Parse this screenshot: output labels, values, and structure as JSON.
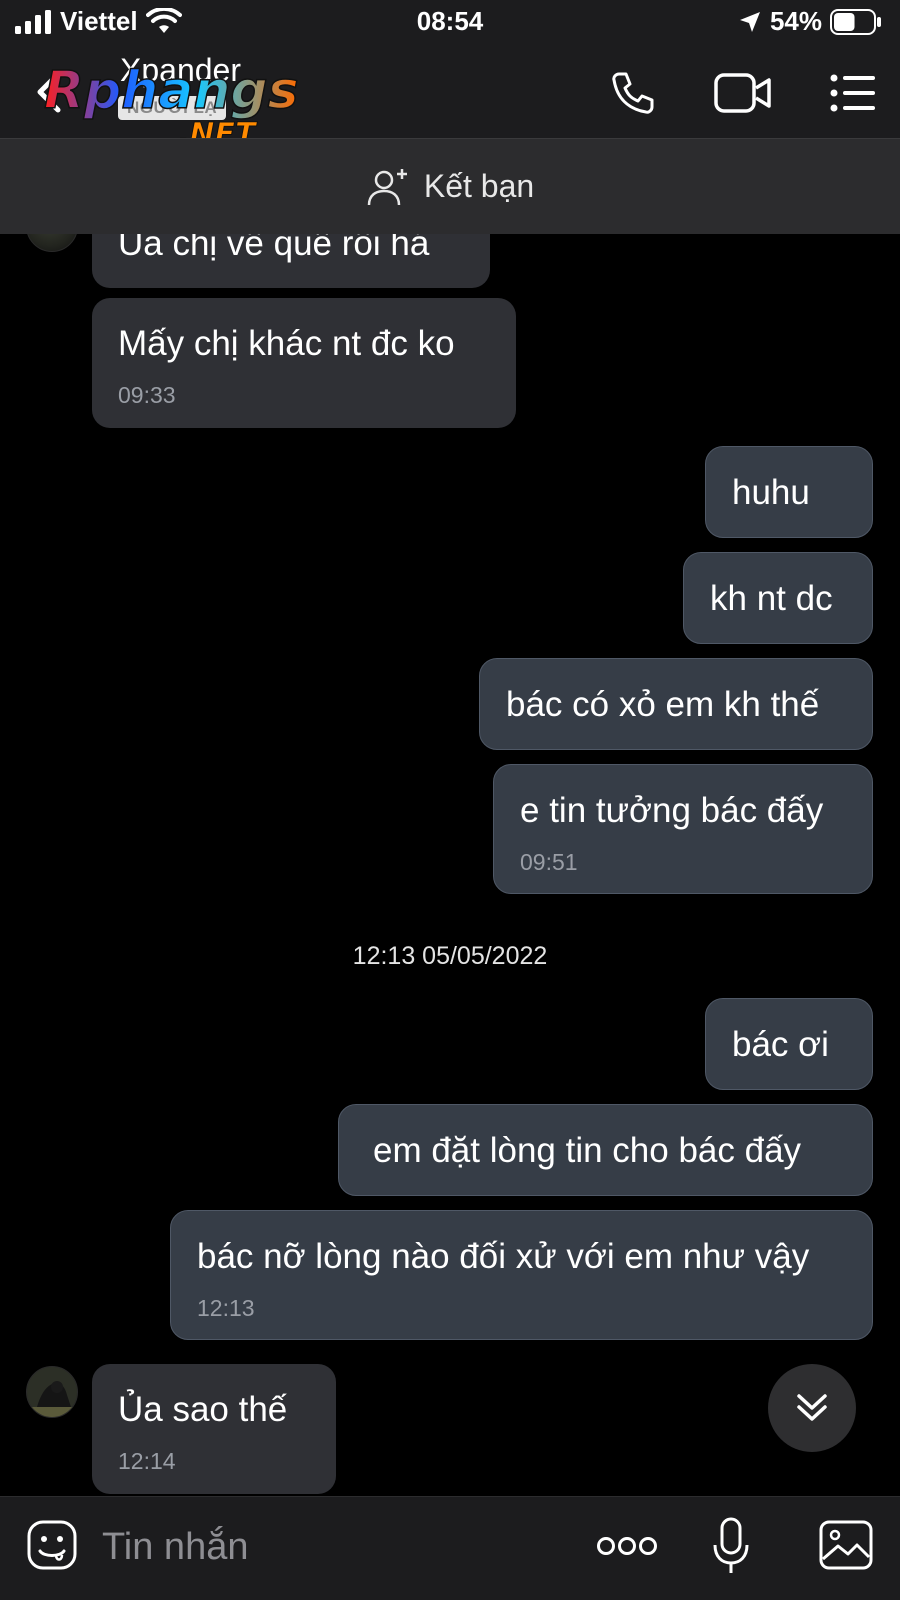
{
  "status": {
    "carrier": "Viettel",
    "time": "08:54",
    "battery": "54%",
    "battery_level": 0.54
  },
  "header": {
    "contact_name": "Xpander",
    "stranger_badge": "NGƯỜI LẠ",
    "watermark": "Rphangs .NET"
  },
  "friend_bar": {
    "label": "Kết bạn"
  },
  "messages": [
    {
      "side": "in",
      "text": "Ủa chị về quê rồi há",
      "time": ""
    },
    {
      "side": "in",
      "text": "Mấy chị khác nt đc ko",
      "time": "09:33"
    },
    {
      "side": "out",
      "text": "huhu",
      "time": ""
    },
    {
      "side": "out",
      "text": "kh nt dc",
      "time": ""
    },
    {
      "side": "out",
      "text": "bác có xỏ em kh thế",
      "time": ""
    },
    {
      "side": "out",
      "text": "e tin tưởng bác đấy",
      "time": "09:51"
    },
    {
      "side": "out",
      "text": "bác ơi",
      "time": ""
    },
    {
      "side": "out",
      "text": "em đặt lòng tin cho bác đấy",
      "time": ""
    },
    {
      "side": "out",
      "text": "bác nỡ lòng nào đối xử với em như vậy",
      "time": "12:13"
    },
    {
      "side": "in",
      "text": "Ủa sao thế",
      "time": "12:14"
    }
  ],
  "date_separator": "12:13 05/05/2022",
  "composer": {
    "placeholder": "Tin nhắn"
  },
  "colors": {
    "incoming_bubble": "#2f3035",
    "outgoing_bubble": "#363d47",
    "background": "#000000"
  },
  "icons": [
    "signal-icon",
    "wifi-icon",
    "location-icon",
    "battery-icon",
    "back-icon",
    "call-icon",
    "video-call-icon",
    "menu-icon",
    "add-friend-icon",
    "scroll-down-icon",
    "emoji-icon",
    "more-icon",
    "microphone-icon",
    "image-icon"
  ]
}
